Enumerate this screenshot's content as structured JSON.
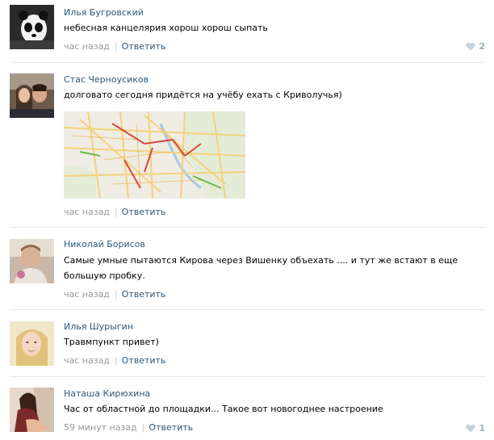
{
  "comments": [
    {
      "author": "Илья Бугровский",
      "text": "небесная канцелярия хорош хорош сыпать",
      "time": "час назад",
      "reply": "Ответить",
      "likes": "2",
      "avatar_icon": "panda-avatar"
    },
    {
      "author": "Стас Черноусиков",
      "text": "долговато сегодня придётся на учёбу ехать с Криволучья)",
      "time": "час назад",
      "reply": "Ответить",
      "avatar_icon": "couple-photo-avatar",
      "attachment": "traffic-map-image"
    },
    {
      "author": "Николай Борисов",
      "text": "Самые умные пытаются Кирова через Вишенку объехать .... и тут же встают в еще большую пробку.",
      "time": "час назад",
      "reply": "Ответить",
      "avatar_icon": "man-photo-avatar"
    },
    {
      "author": "Илья Шурыгин",
      "text": "Травмпункт привет)",
      "time": "час назад",
      "reply": "Ответить",
      "avatar_icon": "girl-photo-avatar"
    },
    {
      "author": "Наташа Кирюхина",
      "text": "Час от областной до площадки... Такое вот новогоднее настроение",
      "time": "59 минут назад",
      "reply": "Ответить",
      "likes": "1",
      "avatar_icon": "woman-photo-avatar"
    }
  ],
  "colors": {
    "link": "#2b587a",
    "meta": "#999999",
    "divider": "#e4e8ec",
    "like": "#9ab0c4"
  }
}
